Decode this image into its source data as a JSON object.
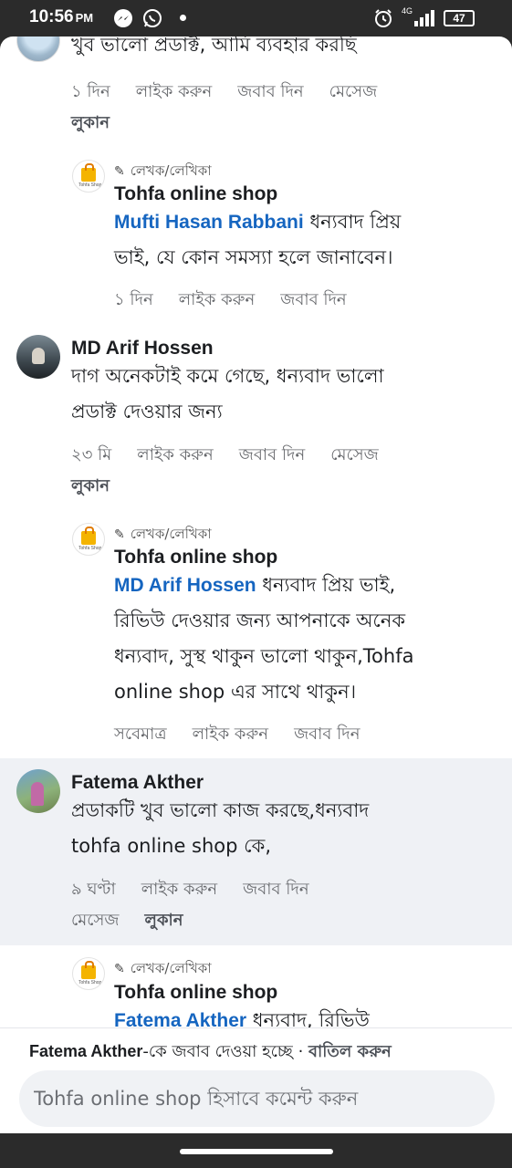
{
  "status_bar": {
    "time": "10:56",
    "ampm": "PM",
    "battery": "47",
    "network": "4G"
  },
  "comments": [
    {
      "id": "c1",
      "text_lines": [
        "খুব ভালো প্রডাক্ট, আমি ব্যবহার করছি"
      ],
      "actions": {
        "time": "১ দিন",
        "like": "লাইক করুন",
        "reply": "জবাব দিন",
        "message": "মেসেজ",
        "hide": "লুকান"
      },
      "reply": {
        "author_badge": "লেখক/লেখিকা",
        "author": "Tohfa online shop",
        "mention": "Mufti Hasan Rabbani",
        "text_lines": [
          " ধন্যবাদ প্রিয়",
          "ভাই, যে কোন সমস্যা হলে জানাবেন।"
        ],
        "actions": {
          "time": "১ দিন",
          "like": "লাইক করুন",
          "reply": "জবাব দিন"
        }
      }
    },
    {
      "id": "c2",
      "author": "MD Arif Hossen",
      "text_lines": [
        "দাগ অনেকটাই কমে  গেছে, ধন্যবাদ ভালো",
        "প্রডাক্ট দেওয়ার জন্য"
      ],
      "actions": {
        "time": "২৩ মি",
        "like": "লাইক করুন",
        "reply": "জবাব দিন",
        "message": "মেসেজ",
        "hide": "লুকান"
      },
      "reply": {
        "author_badge": "লেখক/লেখিকা",
        "author": "Tohfa online shop",
        "mention": "MD Arif Hossen",
        "text_lines": [
          " ধন্যবাদ প্রিয় ভাই,",
          "রিভিউ দেওয়ার জন্য আপনাকে অনেক",
          "ধন্যবাদ, সুস্থ থাকুন ভালো থাকুন,Tohfa",
          "online shop এর সাথে থাকুন।"
        ],
        "actions": {
          "time": "সবেমাত্র",
          "like": "লাইক করুন",
          "reply": "জবাব দিন"
        }
      }
    },
    {
      "id": "c3",
      "author": "Fatema Akther",
      "text_lines": [
        "প্রডাকটি খুব ভালো কাজ করছে,ধন্যবাদ",
        "tohfa online  shop কে,"
      ],
      "actions": {
        "time": "৯ ঘণ্টা",
        "like": "লাইক করুন",
        "reply": "জবাব দিন",
        "message": "মেসেজ",
        "hide": "লুকান"
      },
      "reply": {
        "author_badge": "লেখক/লেখিকা",
        "author": "Tohfa online shop",
        "mention": "Fatema Akther",
        "text_lines": [
          " ধন্যবাদ, রিভিউ"
        ]
      }
    }
  ],
  "reply_bar": {
    "replying_name": "Fatema Akther",
    "replying_text": "-কে জবাব দেওয়া হচ্ছে · ",
    "cancel": "বাতিল করুন",
    "placeholder": "Tohfa online shop হিসাবে কমেন্ট করুন"
  },
  "shop_avatar_text": "Tohfa Shop",
  "colors": {
    "mention": "#1565c0",
    "highlight": "#eff1f5",
    "muted": "#65676b"
  }
}
